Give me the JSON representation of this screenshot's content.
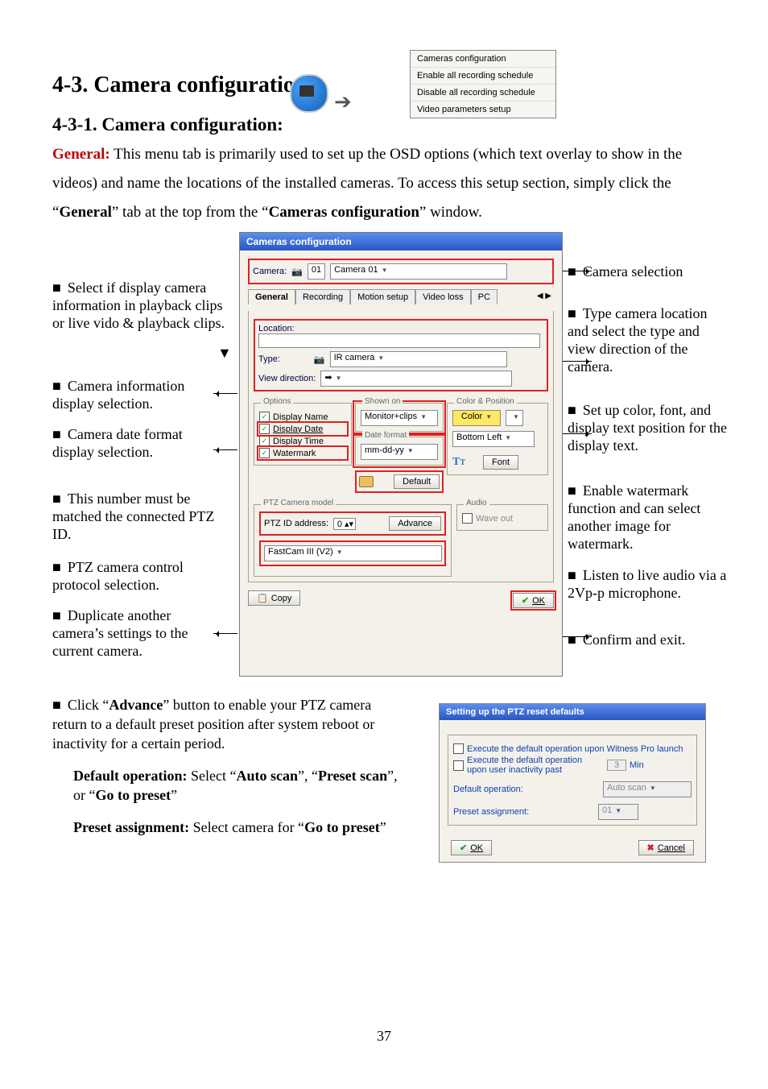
{
  "headings": {
    "h1": "4-3.  Camera configuration",
    "h2": "4-3-1. Camera configuration:"
  },
  "intro": {
    "general_label": "General:",
    "line1": " This menu tab is primarily used to set up the OSD options (which text overlay to show in the videos) and name the locations of the installed cameras. To access this setup section, simply click the “",
    "general_bold": "General",
    "line2": "” tab at the top from the “",
    "camconf_bold": "Cameras configuration",
    "line3": "” window."
  },
  "popup_menu": {
    "items": [
      "Cameras configuration",
      "Enable all recording schedule",
      "Disable all recording schedule",
      "Video parameters setup"
    ]
  },
  "left_annotations": [
    "Select if display camera information in playback clips or live vido & playback clips.",
    "Camera information display selection.",
    "Camera date format display selection.",
    "This number must be matched the connected PTZ ID.",
    "PTZ camera control protocol selection.",
    "Duplicate another camera’s settings to the current camera."
  ],
  "right_annotations": [
    "Camera selection",
    "Type camera location and select the type and view direction of the camera.",
    "Set up color, font, and display text position for the display text.",
    "Enable watermark function and can select another image for watermark.",
    "Listen to live audio via a 2Vp-p microphone.",
    "Confirm and exit."
  ],
  "dialog": {
    "title": "Cameras configuration",
    "camera_label": "Camera:",
    "camera_num": "01",
    "camera_name": "Camera 01",
    "tabs": [
      "General",
      "Recording",
      "Motion setup",
      "Video loss",
      "PC"
    ],
    "tab_nav": "◀ ▶",
    "location_label": "Location:",
    "type_label": "Type:",
    "type_value": "IR camera",
    "viewdir_label": "View direction:",
    "viewdir_value": "➡",
    "options_legend": "Options",
    "shownon_legend": "Shown on",
    "colorpos_legend": "Color & Position",
    "opt_display_name": "Display Name",
    "opt_display_date": "Display Date",
    "opt_display_time": "Display Time",
    "opt_watermark": "Watermark",
    "shownon_value": "Monitor+clips",
    "dateformat_legend": "Date format",
    "dateformat_value": "mm-dd-yy",
    "color_label": "Color",
    "pos_value": "Bottom Left",
    "font_label": "Font",
    "default_btn": "Default",
    "ptz_legend": "PTZ Camera model",
    "audio_legend": "Audio",
    "ptzid_label": "PTZ ID address:",
    "ptzid_value": "0",
    "advance_btn": "Advance",
    "waveout_label": "Wave out",
    "ptzmodel_value": "FastCam III (V2)",
    "copy_btn": "Copy",
    "ok_btn": "OK"
  },
  "ptz_dialog": {
    "title": "Setting up the PTZ reset defaults",
    "opt1": "Execute the default operation upon Witness Pro launch",
    "opt2": "Execute the default operation upon user inactivity past",
    "min_value": "3",
    "min_label": "Min",
    "defop_label": "Default operation:",
    "defop_value": "Auto scan",
    "preset_label": "Preset assignment:",
    "preset_value": "01",
    "ok": "OK",
    "cancel": "Cancel"
  },
  "lower_text": {
    "advance_intro_a": "Click “",
    "advance_bold": "Advance",
    "advance_intro_b": "” button to enable your PTZ camera return to a default preset position after system reboot or inactivity for a certain period.",
    "defop_label": "Default operation:",
    "defop_body_a": " Select “",
    "auto_scan": "Auto scan",
    "defop_body_b": "”, “",
    "preset_scan": "Preset scan",
    "defop_body_c": "”, or “",
    "go_to_preset": "Go to preset",
    "defop_body_d": "”",
    "preset_label": "Preset assignment:",
    "preset_body_a": " Select camera for “",
    "preset_body_b": "”"
  },
  "page_number": "37"
}
